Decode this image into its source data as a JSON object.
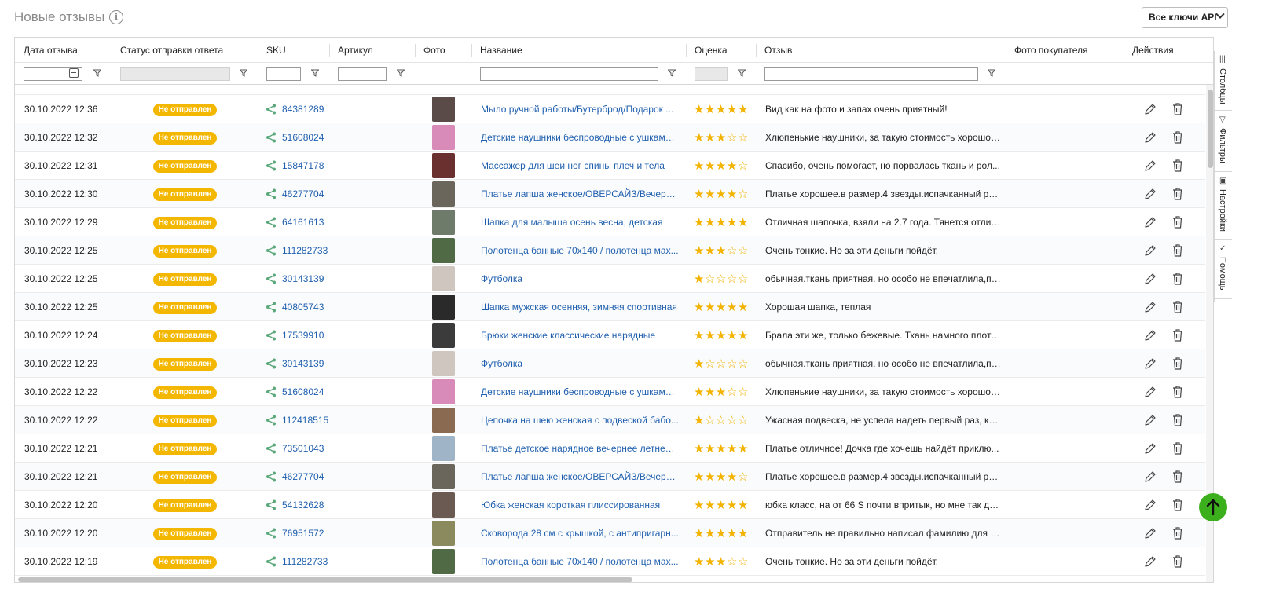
{
  "header": {
    "title": "Новые отзывы",
    "info_icon": "info-icon",
    "api_select": "Все ключи API"
  },
  "columns": [
    "Дата отзыва",
    "Статус отправки ответа",
    "SKU",
    "Артикул",
    "Фото",
    "Название",
    "Оценка",
    "Отзыв",
    "Фото покупателя",
    "Действия"
  ],
  "side_panel": [
    "Столбцы",
    "Фильтры",
    "Настройки",
    "Помощь"
  ],
  "status_color": "#f4b700",
  "link_color": "#1f5fae",
  "rows": [
    {
      "date": "30.10.2022 12:36",
      "status": "Не отправлен",
      "sku": "84381289",
      "name": "Мыло ручной работы/Бутерброд/Подарок ...",
      "rating": 5,
      "review": "Вид как на фото и запах очень приятный!",
      "thumb": "#5a4a48"
    },
    {
      "date": "30.10.2022 12:32",
      "status": "Не отправлен",
      "sku": "51608024",
      "name": "Детские наушники беспроводные с ушками ...",
      "rating": 3,
      "review": "Хлюпенькие наушники, за такую стоимость хорошо,...",
      "thumb": "#d88ab8"
    },
    {
      "date": "30.10.2022 12:31",
      "status": "Не отправлен",
      "sku": "15847178",
      "name": "Массажер для шеи ног спины плеч и тела",
      "rating": 4,
      "review": "Спасибо, очень помогает, но порвалась ткань и рол...",
      "thumb": "#6a3030"
    },
    {
      "date": "30.10.2022 12:30",
      "status": "Не отправлен",
      "sku": "46277704",
      "name": "Платье лапша женское/ОВЕРСАЙЗ/Вечерне...",
      "rating": 4,
      "review": "Платье хорошее.в размер.4 звезды.испачканный рук...",
      "thumb": "#6b665c"
    },
    {
      "date": "30.10.2022 12:29",
      "status": "Не отправлен",
      "sku": "64161613",
      "name": "Шапка для малыша осень весна, детская",
      "rating": 5,
      "review": "Отличная шапочка, взяли на 2.7 года. Тянется отлич...",
      "thumb": "#6e7a6a"
    },
    {
      "date": "30.10.2022 12:25",
      "status": "Не отправлен",
      "sku": "111282733",
      "name": "Полотенца банные 70х140 / полотенца мах...",
      "rating": 3,
      "review": "Очень тонкие. Но за эти деньги пойдёт.",
      "thumb": "#4f6a44"
    },
    {
      "date": "30.10.2022 12:25",
      "status": "Не отправлен",
      "sku": "30143139",
      "name": "Футболка",
      "rating": 1,
      "review": "обычная.ткань приятная. но особо не впечатлила,по...",
      "thumb": "#cfc6bf"
    },
    {
      "date": "30.10.2022 12:25",
      "status": "Не отправлен",
      "sku": "40805743",
      "name": "Шапка мужская осенняя, зимняя спортивная",
      "rating": 5,
      "review": "Хорошая шапка, теплая",
      "thumb": "#2a2a2a"
    },
    {
      "date": "30.10.2022 12:24",
      "status": "Не отправлен",
      "sku": "17539910",
      "name": "Брюки женские классические нарядные",
      "rating": 5,
      "review": "Брала эти же, только бежевые. Ткань намного плотн...",
      "thumb": "#3b3b3b"
    },
    {
      "date": "30.10.2022 12:23",
      "status": "Не отправлен",
      "sku": "30143139",
      "name": "Футболка",
      "rating": 1,
      "review": "обычная.ткань приятная. но особо не впечатлила,по...",
      "thumb": "#cfc6bf"
    },
    {
      "date": "30.10.2022 12:22",
      "status": "Не отправлен",
      "sku": "51608024",
      "name": "Детские наушники беспроводные с ушками ...",
      "rating": 3,
      "review": "Хлюпенькие наушники, за такую стоимость хорошо,...",
      "thumb": "#d88ab8"
    },
    {
      "date": "30.10.2022 12:22",
      "status": "Не отправлен",
      "sku": "112418515",
      "name": "Цепочка на шею женская с подвеской бабо...",
      "rating": 1,
      "review": "Ужасная подвеска, не успела надеть первый раз, как...",
      "thumb": "#8a6a50"
    },
    {
      "date": "30.10.2022 12:21",
      "status": "Не отправлен",
      "sku": "73501043",
      "name": "Платье детское нарядное вечернее летнее ...",
      "rating": 5,
      "review": "Платье отличное! Дочка где хочешь найдёт приклю...",
      "thumb": "#9fb4c6"
    },
    {
      "date": "30.10.2022 12:21",
      "status": "Не отправлен",
      "sku": "46277704",
      "name": "Платье лапша женское/ОВЕРСАЙЗ/Вечерне...",
      "rating": 4,
      "review": "Платье хорошее.в размер.4 звезды.испачканный рук...",
      "thumb": "#6b665c"
    },
    {
      "date": "30.10.2022 12:20",
      "status": "Не отправлен",
      "sku": "54132628",
      "name": "Юбка женская короткая плиссированная",
      "rating": 5,
      "review": "юбка класс, на от 66 S почти впритык, но мне так да...",
      "thumb": "#6b5a52"
    },
    {
      "date": "30.10.2022 12:20",
      "status": "Не отправлен",
      "sku": "76951572",
      "name": "Сковорода 28 см с крышкой, с антипригарн...",
      "rating": 5,
      "review": "Отправитель не правильно написал фамилию для п...",
      "thumb": "#8a8a5e"
    },
    {
      "date": "30.10.2022 12:19",
      "status": "Не отправлен",
      "sku": "111282733",
      "name": "Полотенца банные 70х140 / полотенца мах...",
      "rating": 3,
      "review": "Очень тонкие. Но за эти деньги пойдёт.",
      "thumb": "#4f6a44"
    }
  ]
}
